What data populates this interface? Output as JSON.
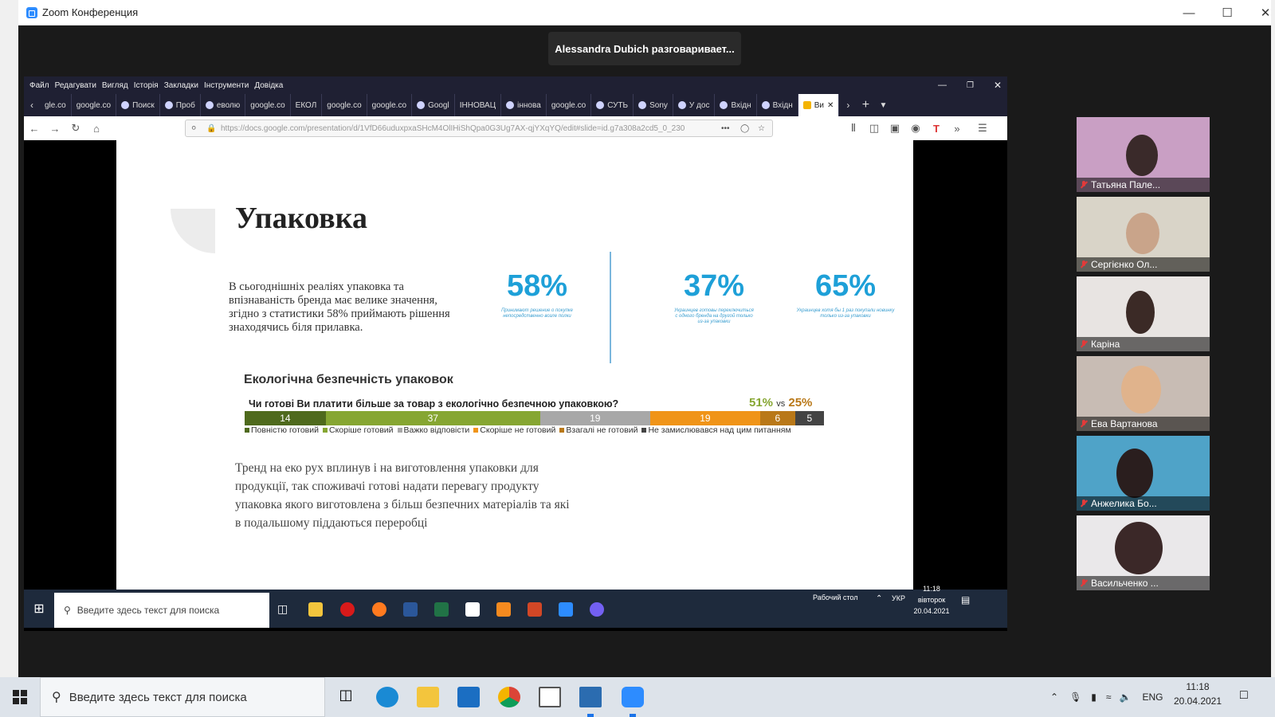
{
  "zoom": {
    "title": "Zoom Конференция",
    "speaker": "Alessandra Dubich разговаривает..."
  },
  "firefox": {
    "menu": [
      "Файл",
      "Редагувати",
      "Вигляд",
      "Історія",
      "Закладки",
      "Інструменти",
      "Довідка"
    ],
    "tabs": [
      "gle.co",
      "google.co",
      "Поиск",
      "Проб",
      "еволю",
      "google.co",
      "ЕКОЛ",
      "google.co",
      "google.co",
      "Googl",
      "ІННОВАЦ",
      "інновa",
      "google.co",
      "СУТЬ",
      "Sony",
      "У дос",
      "Вхідн",
      "Вхідн",
      "Ви"
    ],
    "url": "https://docs.google.com/presentation/d/1VfD66uduxpxaSHcM4OlIHiShQpa0G3Ug7AX-qjYXqYQ/edit#slide=id.g7a308a2cd5_0_230"
  },
  "slide": {
    "title": "Упаковка",
    "intro": "В сьогоднішніх реаліях упаковка та впізнаваність бренда  має велике значення, згідно з статистики 58% приймають рішення знаходячись біля прилавка.",
    "stats": [
      {
        "value": "58%",
        "caption": "Принимают решение о покупке непосредственно возле полки"
      },
      {
        "value": "37%",
        "caption": "Украинцев готовы переключиться с одного бренда на другой только из-за упаковки"
      },
      {
        "value": "65%",
        "caption": "Украинцев хотя бы 1 раз покупали новинку только из-за упаковки"
      }
    ],
    "eco_title": "Екологічна безпечність упаковок",
    "question": "Чи готові  Ви платити  більше за товар з екологічно безпечною упаковкою?",
    "ratio_a": "51%",
    "ratio_vs": "vs",
    "ratio_b": "25%",
    "bar": [
      {
        "label": "Повністю готовий",
        "value": 14,
        "color": "#4f6a1d"
      },
      {
        "label": "Скоріше готовий",
        "value": 37,
        "color": "#86a632"
      },
      {
        "label": "Важко відповісти",
        "value": 19,
        "color": "#a8a8a8"
      },
      {
        "label": "Скоріше не готовий",
        "value": 19,
        "color": "#f09418"
      },
      {
        "label": "Взагалі не готовий",
        "value": 6,
        "color": "#b97818"
      },
      {
        "label": "Не замислювався над цим питанням",
        "value": 5,
        "color": "#444444"
      }
    ],
    "trend": "Тренд на еко рух вплинув  і на виготовлення упаковки для продукції, так споживачі готові надати перевагу продукту упаковка якого виготовлена з більш безпечних матеріалів та які в подальшому піддаються переробці"
  },
  "inner_taskbar": {
    "search_placeholder": "Введите здесь текст для поиска",
    "desktop_label": "Рабочий стол",
    "lang": "УКР",
    "time": "11:18",
    "day": "вівторок",
    "date": "20.04.2021"
  },
  "participants": [
    {
      "name": "Татьяна Пале..."
    },
    {
      "name": "Сергієнко Ол..."
    },
    {
      "name": "Каріна"
    },
    {
      "name": "Ева Вартанова"
    },
    {
      "name": "Анжелика Бо..."
    },
    {
      "name": "Васильченко ..."
    }
  ],
  "taskbar": {
    "search_placeholder": "Введите здесь текст для поиска",
    "lang": "ENG",
    "time": "11:18",
    "date": "20.04.2021"
  }
}
